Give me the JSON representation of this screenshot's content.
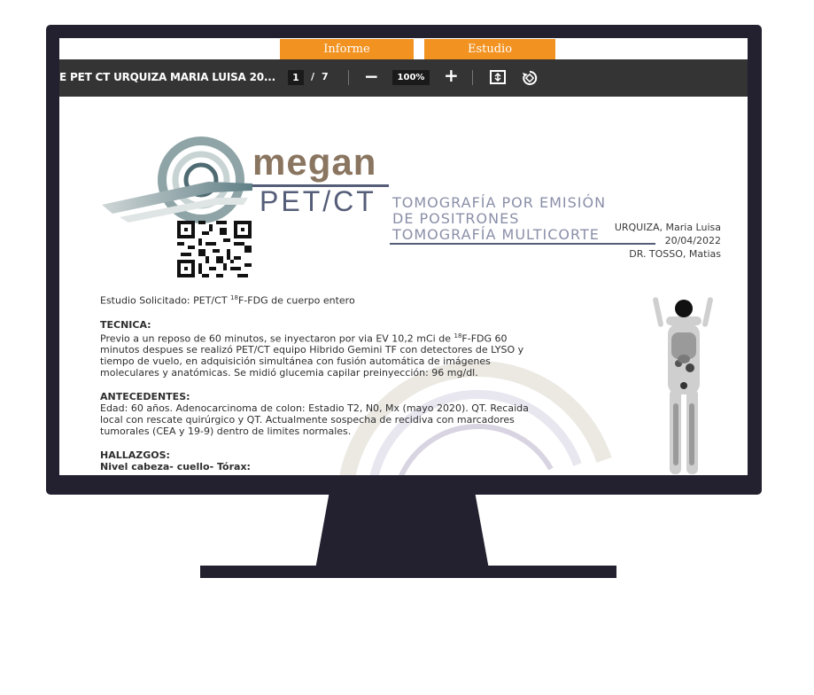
{
  "tabs": [
    {
      "label": "Informe"
    },
    {
      "label": "Estudio"
    }
  ],
  "toolbar": {
    "doc_title": "E PET CT URQUIZA MARIA LUISA 20...",
    "current_page": "1",
    "page_separator": "/",
    "total_pages": "7",
    "zoom_out_label": "−",
    "zoom_level": "100%",
    "zoom_in_label": "+",
    "icons": [
      "fit-page-icon",
      "rotate-icon"
    ]
  },
  "document": {
    "logo": {
      "brand": "megan",
      "sub": "PET/CT",
      "lines": [
        "TOMOGRAFÍA POR EMISIÓN",
        "DE POSITRONES",
        "TOMOGRAFÍA MULTICORTE"
      ]
    },
    "patient": {
      "name": "URQUIZA, Maria Luisa",
      "date": "20/04/2022",
      "doctor": "DR. TOSSO, Matias"
    },
    "study_line": {
      "prefix": "Estudio Solicitado: PET/CT ",
      "sup": "18",
      "suffix": "F-FDG de cuerpo entero"
    },
    "tecnica": {
      "heading": "TECNICA:",
      "line1_a": "Previo a un reposo de 60 minutos, se inyectaron por via EV 10,2 mCi de ",
      "line1_sup": "18",
      "line1_b": "F-FDG 60",
      "line2": "minutos despues se realizó PET/CT equipo Hibrido Gemini TF con detectores de LYSO y",
      "line3": "tiempo de vuelo, en adquisición simultánea con fusión automática de imágenes",
      "line4": "moleculares y anatómicas. Se midió glucemia capilar preinyección: 96 mg/dl."
    },
    "antecedentes": {
      "heading": "ANTECEDENTES:",
      "line1": "Edad: 60 años. Adenocarcinoma de colon: Estadio T2, N0, Mx (mayo 2020). QT. Recaida",
      "line2": "local con rescate quirúrgico y QT. Actualmente sospecha de recidiva con marcadores",
      "line3": "tumorales (CEA y 19-9) dentro de limites normales."
    },
    "hallazgos": {
      "heading": "HALLAZGOS:",
      "sub": "Nivel cabeza- cuello- Tórax:"
    }
  },
  "colors": {
    "monitor": "#23202f",
    "tab": "#f29221",
    "toolbar": "#343434",
    "logo_brown": "#8a7560",
    "logo_slate": "#555d78"
  }
}
